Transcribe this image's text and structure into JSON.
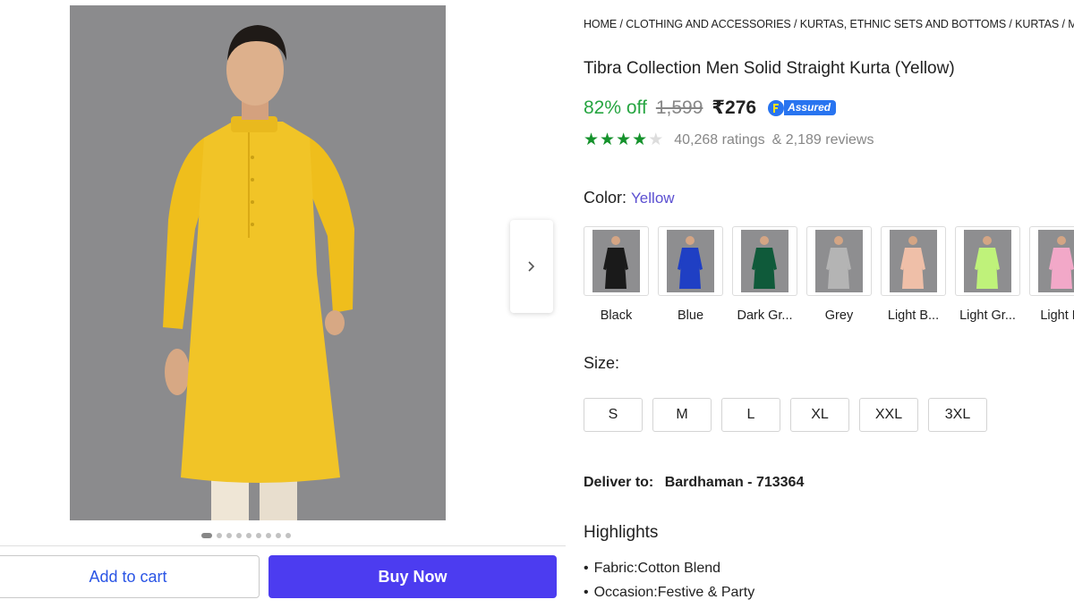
{
  "breadcrumb": "HOME / CLOTHING AND ACCESSORIES / KURTAS, ETHNIC SETS AND BOTTOMS / KURTAS / MEN",
  "product": {
    "title": "Tibra Collection Men Solid Straight Kurta (Yellow)",
    "discount": "82% off",
    "mrp": "1,599",
    "price": "₹276",
    "assured_label": "Assured",
    "rating_stars": 4,
    "ratings": "40,268 ratings",
    "reviews": "& 2,189 reviews"
  },
  "color": {
    "label": "Color:",
    "selected": "Yellow",
    "options": [
      {
        "name": "Black",
        "hex": "#1a1a1a"
      },
      {
        "name": "Blue",
        "hex": "#1f3fc4"
      },
      {
        "name": "Dark Gr...",
        "hex": "#0f5a3a"
      },
      {
        "name": "Grey",
        "hex": "#b4b4b4"
      },
      {
        "name": "Light B...",
        "hex": "#efbfa8"
      },
      {
        "name": "Light Gr...",
        "hex": "#bff27a"
      },
      {
        "name": "Light Pi",
        "hex": "#f2a8c8"
      }
    ]
  },
  "size": {
    "label": "Size:",
    "options": [
      "S",
      "M",
      "L",
      "XL",
      "XXL",
      "3XL"
    ]
  },
  "delivery": {
    "label": "Deliver to:",
    "location": "Bardhaman - 713364"
  },
  "highlights": {
    "title": "Highlights",
    "items": [
      "Fabric:Cotton Blend",
      "Occasion:Festive & Party"
    ]
  },
  "actions": {
    "add_to_cart": "Add to cart",
    "buy_now": "Buy Now"
  },
  "gallery": {
    "image_count": 9,
    "active_index": 0,
    "main_color": "#f2c32a"
  }
}
